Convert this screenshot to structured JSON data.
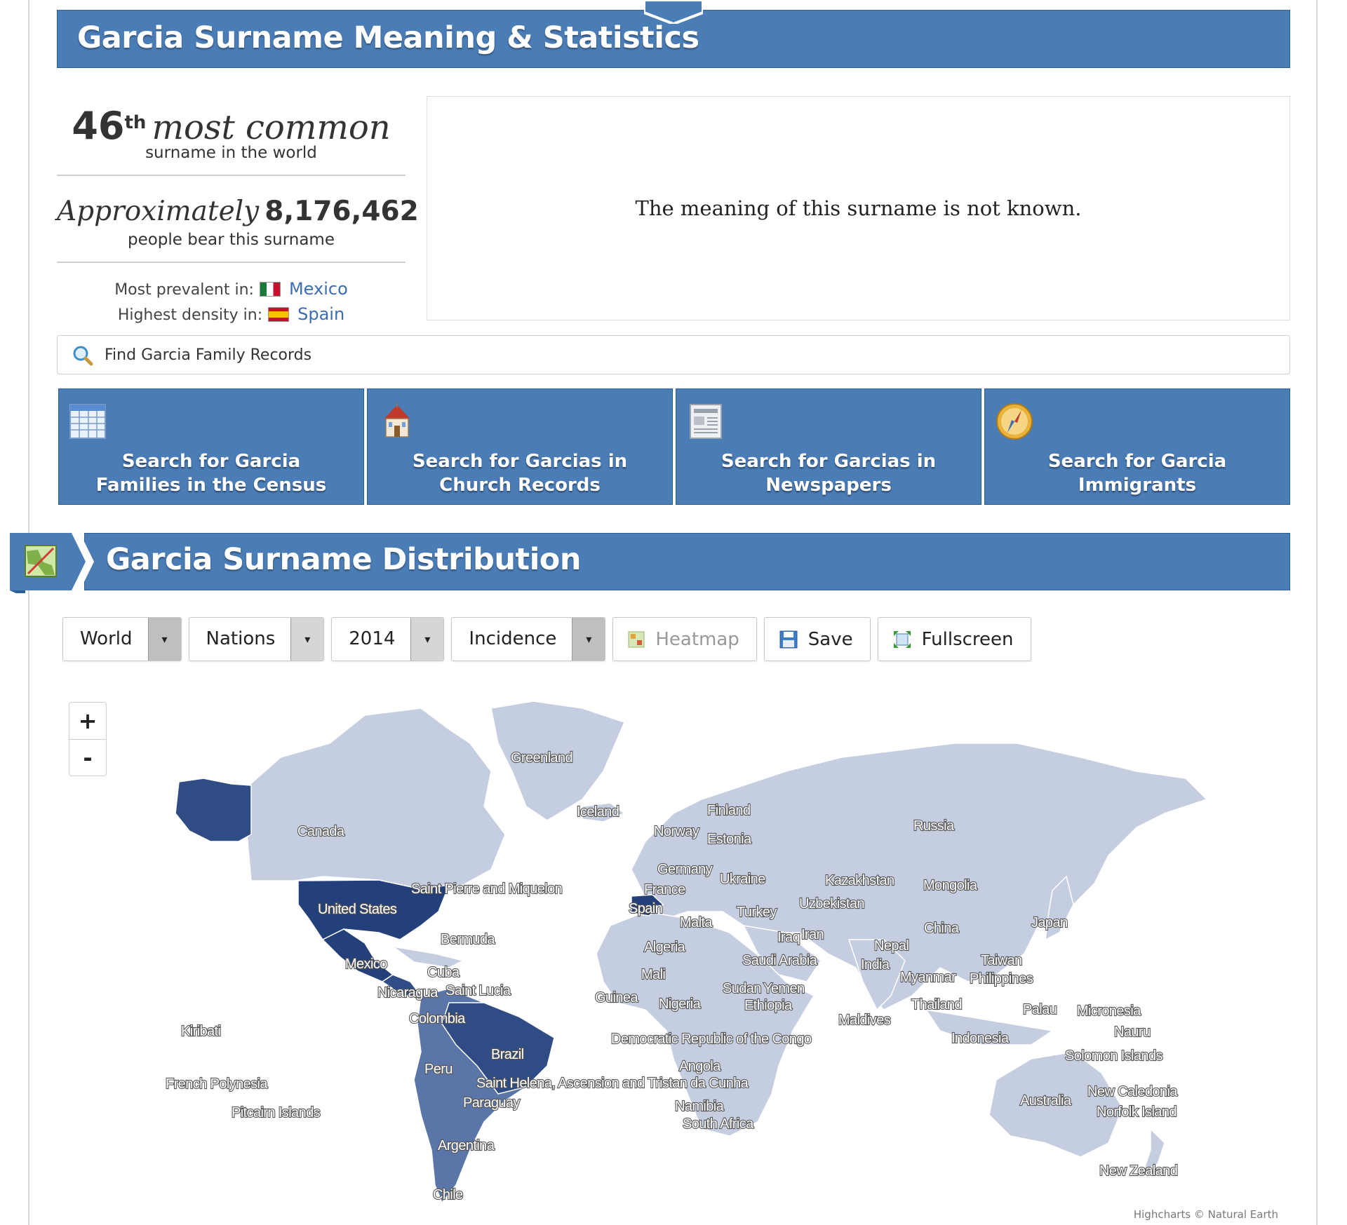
{
  "header": {
    "title": "Garcia Surname Meaning & Statistics"
  },
  "stats": {
    "rank_number": "46",
    "rank_suffix": "th",
    "rank_text": "most common",
    "rank_sub": "surname in the world",
    "pop_prefix": "Approximately",
    "pop_number": "8,176,462",
    "pop_sub": "people bear this surname",
    "prevalent_label": "Most prevalent in:",
    "prevalent_country": "Mexico",
    "density_label": "Highest density in:",
    "density_country": "Spain"
  },
  "meaning": {
    "text": "The meaning of this surname is not known."
  },
  "search": {
    "label": "Find Garcia Family Records"
  },
  "tiles": [
    {
      "line1": "Search for Garcia",
      "line2": "Families in the Census",
      "icon": "census-table-icon"
    },
    {
      "line1": "Search for Garcias in",
      "line2": "Church Records",
      "icon": "church-icon"
    },
    {
      "line1": "Search for Garcias in",
      "line2": "Newspapers",
      "icon": "newspaper-icon"
    },
    {
      "line1": "Search for Garcia",
      "line2": "Immigrants",
      "icon": "compass-icon"
    }
  ],
  "distribution": {
    "title": "Garcia Surname Distribution",
    "badge_icon": "map-icon"
  },
  "controls": {
    "region": "World",
    "level": "Nations",
    "year": "2014",
    "measure": "Incidence",
    "heatmap": "Heatmap",
    "save": "Save",
    "fullscreen": "Fullscreen"
  },
  "map": {
    "zoom_in": "+",
    "zoom_out": "-",
    "credits": "Highcharts © Natural Earth",
    "colors": {
      "base": "#c5cde0",
      "medium": "#5a75a8",
      "dark": "#2f4c85",
      "darkest": "#24407a"
    },
    "labels": {
      "greenland": "Greenland",
      "iceland": "Iceland",
      "finland": "Finland",
      "norway": "Norway",
      "estonia": "Estonia",
      "russia": "Russia",
      "canada": "Canada",
      "germany": "Germany",
      "ukraine": "Ukraine",
      "kazakhstan": "Kazakhstan",
      "mongolia": "Mongolia",
      "saint_pierre": "Saint Pierre and Miquelon",
      "france": "France",
      "uzbekistan": "Uzbekistan",
      "united_states": "United States",
      "spain": "Spain",
      "turkey": "Turkey",
      "malta": "Malta",
      "iraq": "Iraq",
      "iran": "Iran",
      "china": "China",
      "japan": "Japan",
      "bermuda": "Bermuda",
      "algeria": "Algeria",
      "nepal": "Nepal",
      "saudi_arabia": "Saudi Arabia",
      "india": "India",
      "mexico": "Mexico",
      "mali": "Mali",
      "taiwan": "Taiwan",
      "cuba": "Cuba",
      "myanmar": "Myanmar",
      "philippines": "Philippines",
      "sudan": "Sudan",
      "yemen": "Yemen",
      "nicaragua": "Nicaragua",
      "saint_lucia": "Saint Lucia",
      "guinea": "Guinea",
      "nigeria": "Nigeria",
      "ethiopia": "Ethiopia",
      "thailand": "Thailand",
      "palau": "Palau",
      "micronesia": "Micronesia",
      "colombia": "Colombia",
      "maldives": "Maldives",
      "kiribati": "Kiribati",
      "nauru": "Nauru",
      "drc": "Democratic Republic of the Congo",
      "indonesia": "Indonesia",
      "brazil": "Brazil",
      "solomon": "Solomon Islands",
      "angola": "Angola",
      "peru": "Peru",
      "saint_helena": "Saint Helena, Ascension and Tristan da Cunha",
      "french_polynesia": "French Polynesia",
      "new_caledonia": "New Caledonia",
      "paraguay": "Paraguay",
      "australia": "Australia",
      "namibia": "Namibia",
      "norfolk": "Norfolk Island",
      "pitcairn": "Pitcairn Islands",
      "south_africa": "South Africa",
      "argentina": "Argentina",
      "new_zealand": "New Zealand",
      "chile": "Chile"
    }
  }
}
